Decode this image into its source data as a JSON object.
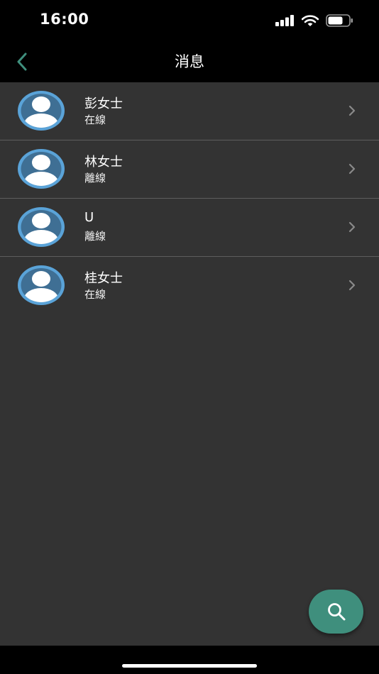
{
  "status_bar": {
    "time": "16:00"
  },
  "nav": {
    "title": "消息"
  },
  "contacts": [
    {
      "name": "彭女士",
      "status": "在線"
    },
    {
      "name": "林女士",
      "status": "離線"
    },
    {
      "name": "U",
      "status": "離線"
    },
    {
      "name": "桂女士",
      "status": "在線"
    }
  ],
  "colors": {
    "accent": "#3f8f7d",
    "background": "#333333",
    "bar": "#000000",
    "avatar_ring": "#5aa3d8"
  },
  "icons": {
    "back": "chevron-left-icon",
    "row": "chevron-right-icon",
    "avatar": "user-silhouette-icon",
    "fab": "search-icon"
  }
}
